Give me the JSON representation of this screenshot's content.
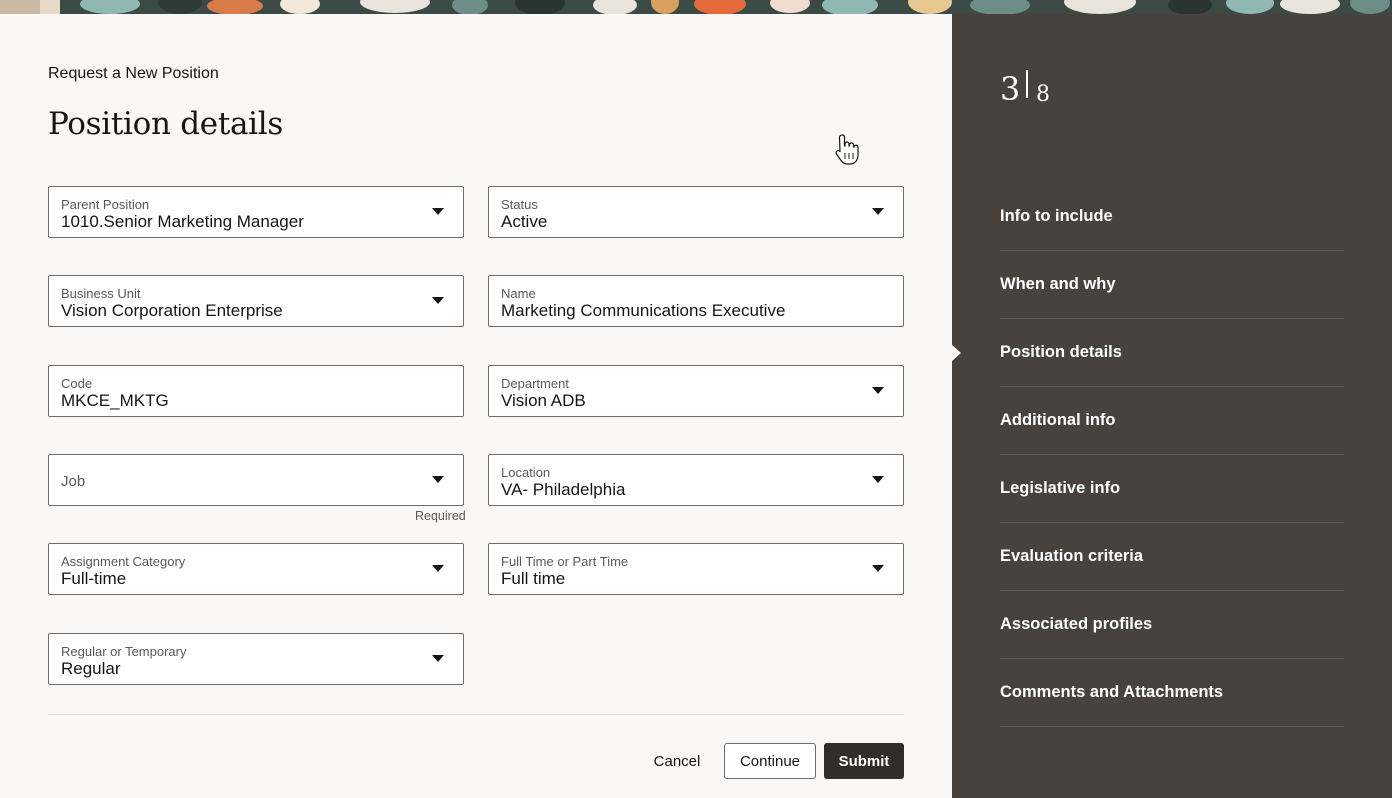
{
  "header": {
    "eyebrow": "Request a New Position",
    "title": "Position details"
  },
  "fields": {
    "parent_position": {
      "label": "Parent Position",
      "value": "1010.Senior Marketing Manager"
    },
    "status": {
      "label": "Status",
      "value": "Active"
    },
    "business_unit": {
      "label": "Business Unit",
      "value": "Vision Corporation Enterprise"
    },
    "name": {
      "label": "Name",
      "value": "Marketing Communications Executive"
    },
    "code": {
      "label": "Code",
      "value": "MKCE_MKTG"
    },
    "department": {
      "label": "Department",
      "value": "Vision ADB"
    },
    "job": {
      "label": "Job",
      "value": "",
      "helper": "Required"
    },
    "location": {
      "label": "Location",
      "value": "VA- Philadelphia"
    },
    "assignment_category": {
      "label": "Assignment Category",
      "value": "Full-time"
    },
    "full_part_time": {
      "label": "Full Time or Part Time",
      "value": "Full time"
    },
    "regular_temporary": {
      "label": "Regular or Temporary",
      "value": "Regular"
    }
  },
  "actions": {
    "cancel": "Cancel",
    "continue": "Continue",
    "submit": "Submit"
  },
  "sidebar": {
    "current_step": "3",
    "total_steps": "8",
    "active_item": "Position details",
    "items": [
      {
        "label": "Info to include"
      },
      {
        "label": "When and why"
      },
      {
        "label": "Position details"
      },
      {
        "label": "Additional info"
      },
      {
        "label": "Legislative info"
      },
      {
        "label": "Evaluation criteria"
      },
      {
        "label": "Associated profiles"
      },
      {
        "label": "Comments and Attachments"
      }
    ]
  },
  "colors": {
    "page_background": "#f9f8f6",
    "sidebar_background": "#47423e",
    "submit_background": "#312d2a",
    "banner_base": "#3b4a45"
  },
  "icons": {
    "dropdown": "chevron-down-icon",
    "cursor": "hand-pointer-icon"
  }
}
